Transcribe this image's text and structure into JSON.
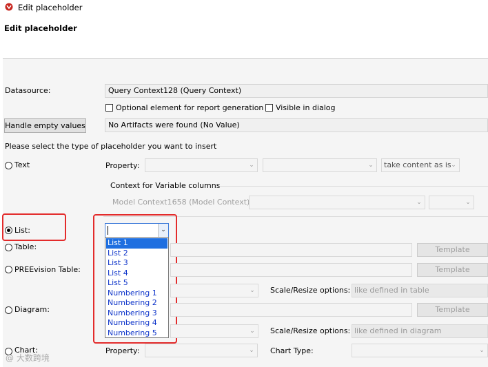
{
  "window": {
    "title": "Edit placeholder",
    "heading": "Edit placeholder"
  },
  "datasource": {
    "label": "Datasource:",
    "value": "Query Context128 (Query Context)",
    "optional_label": "Optional element for report generation",
    "visible_label": "Visible in dialog",
    "handle_empty_label": "Handle empty values",
    "empty_value": "No Artifacts were found (No Value)"
  },
  "instruction": "Please select the type of placeholder you want to insert",
  "text_option": {
    "label": "Text",
    "property_label": "Property:",
    "take_content": "take content as is",
    "context_title": "Context for Variable columns",
    "model_context": "Model Context1658 (Model Context)"
  },
  "list_option": {
    "label": "List:",
    "selected": "",
    "options": [
      "List 1",
      "List 2",
      "List 3",
      "List 4",
      "List 5",
      "Numbering 1",
      "Numbering 2",
      "Numbering 3",
      "Numbering 4",
      "Numbering 5"
    ]
  },
  "table_option": {
    "label": "Table:",
    "template_label": "Template"
  },
  "preevision_option": {
    "label": "PREEvision Table:",
    "template_label": "Template"
  },
  "scale_table": {
    "label": "Scale/Resize options:",
    "value": "like defined in table"
  },
  "diagram_option": {
    "label": "Diagram:",
    "template_label": "Template"
  },
  "scale_diagram": {
    "label": "Scale/Resize options:",
    "value": "like defined in diagram"
  },
  "chart_option": {
    "label": "Chart:",
    "property_label": "Property:",
    "chart_type_label": "Chart Type:"
  },
  "watermark": "@ 大数跨境"
}
